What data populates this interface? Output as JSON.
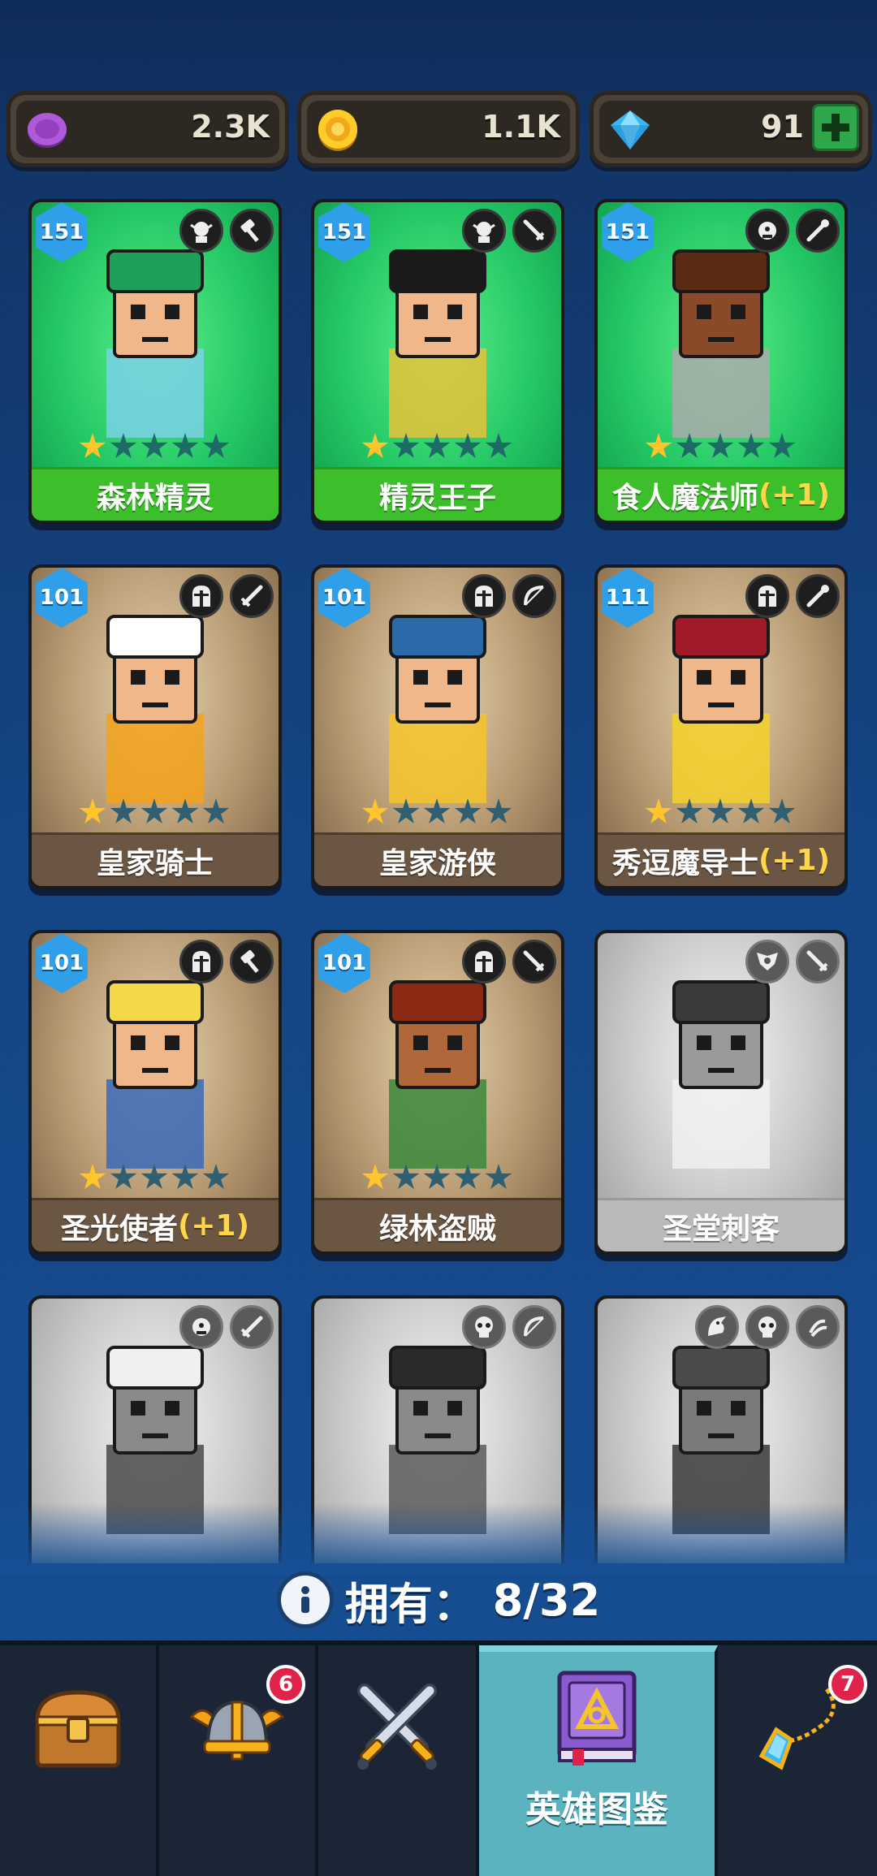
{
  "currencies": {
    "purple": {
      "icon": "purple-coin-icon",
      "value": "2.3K"
    },
    "gold": {
      "icon": "gold-coin-icon",
      "value": "1.1K"
    },
    "gem": {
      "icon": "blue-gem-icon",
      "value": "91",
      "plus_icon": "plus-icon"
    }
  },
  "heroes": [
    {
      "name": "森林精灵",
      "bonus": "",
      "level": "151",
      "stars": 1,
      "state": "owned-green",
      "class_icons": [
        "elf-class-icon",
        "hammer-icon"
      ]
    },
    {
      "name": "精灵王子",
      "bonus": "",
      "level": "151",
      "stars": 1,
      "state": "owned-green",
      "class_icons": [
        "elf-class-icon",
        "dagger-icon"
      ]
    },
    {
      "name": "食人魔法师",
      "bonus": "(+1)",
      "level": "151",
      "stars": 1,
      "state": "owned-green",
      "class_icons": [
        "ogre-class-icon",
        "staff-icon"
      ]
    },
    {
      "name": "皇家骑士",
      "bonus": "",
      "level": "101",
      "stars": 1,
      "state": "owned-brown",
      "class_icons": [
        "helmet-class-icon",
        "sword-icon"
      ]
    },
    {
      "name": "皇家游侠",
      "bonus": "",
      "level": "101",
      "stars": 1,
      "state": "owned-brown",
      "class_icons": [
        "helmet-class-icon",
        "bow-icon"
      ]
    },
    {
      "name": "秀逗魔导士",
      "bonus": "(+1)",
      "level": "111",
      "stars": 1,
      "state": "owned-brown",
      "class_icons": [
        "helmet-class-icon",
        "staff-icon"
      ]
    },
    {
      "name": "圣光使者",
      "bonus": "(+1)",
      "level": "101",
      "stars": 1,
      "state": "owned-brown",
      "class_icons": [
        "helmet-class-icon",
        "hammer-icon"
      ]
    },
    {
      "name": "绿林盗贼",
      "bonus": "",
      "level": "101",
      "stars": 1,
      "state": "owned-brown",
      "class_icons": [
        "helmet-class-icon",
        "dagger-icon"
      ]
    },
    {
      "name": "圣堂刺客",
      "bonus": "",
      "level": "",
      "stars": 0,
      "state": "locked",
      "class_icons": [
        "winged-class-icon",
        "dagger-icon"
      ]
    },
    {
      "name": "",
      "bonus": "",
      "level": "",
      "stars": 0,
      "state": "locked",
      "class_icons": [
        "ogre-class-icon",
        "sword-icon"
      ]
    },
    {
      "name": "",
      "bonus": "",
      "level": "",
      "stars": 0,
      "state": "locked",
      "class_icons": [
        "skull-class-icon",
        "bow-icon"
      ]
    },
    {
      "name": "",
      "bonus": "",
      "level": "",
      "stars": 0,
      "state": "locked",
      "class_icons": [
        "dragon-class-icon",
        "skull-class-icon",
        "claw-icon"
      ]
    }
  ],
  "owned": {
    "label": "拥有：",
    "value": "8/32",
    "icon": "info-icon"
  },
  "nav": {
    "tabs": [
      {
        "icon": "treasure-chest-icon",
        "label": "",
        "badge": ""
      },
      {
        "icon": "viking-helmet-icon",
        "label": "",
        "badge": "6"
      },
      {
        "icon": "crossed-swords-icon",
        "label": "",
        "badge": ""
      },
      {
        "icon": "hero-book-icon",
        "label": "英雄图鉴",
        "badge": "",
        "active": true
      },
      {
        "icon": "amulet-icon",
        "label": "",
        "badge": "7"
      }
    ]
  },
  "colors": {
    "background": "#144585",
    "card_green": "#25c866",
    "card_brown": "#b59870",
    "card_locked": "#c8c8c8",
    "star_filled": "#ffc52a",
    "bonus_text": "#ffd54a",
    "nav_active": "#5bb3c0",
    "badge_red": "#e0234a"
  }
}
